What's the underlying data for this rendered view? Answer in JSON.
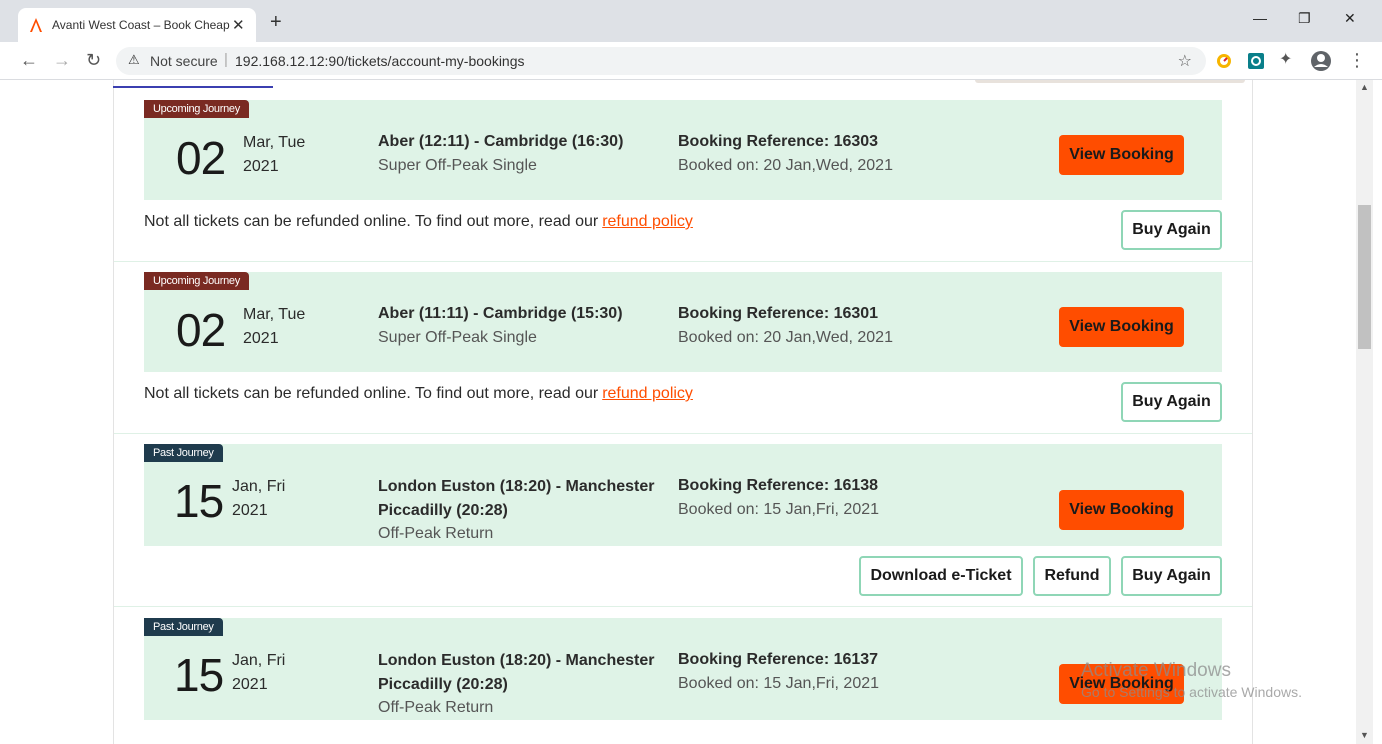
{
  "browser": {
    "tab_title": "Avanti West Coast – Book Cheap",
    "tab_close": "✕",
    "new_tab": "+",
    "not_secure": "Not secure",
    "url": "192.168.12.12:90/tickets/account-my-bookings"
  },
  "bookings": [
    {
      "badge": "Upcoming Journey",
      "day": "02",
      "mon": "Mar, Tue",
      "year": "2021",
      "route": "Aber (12:11) - Cambridge (16:30)",
      "ticket": "Super Off-Peak Single",
      "ref": "Booking Reference: 16303",
      "booked": "Booked on: 20 Jan,Wed, 2021",
      "view": "View Booking",
      "note": "Not all tickets can be refunded online. To find out more, read our",
      "link": "refund policy",
      "buy": "Buy Again"
    },
    {
      "badge": "Upcoming Journey",
      "day": "02",
      "mon": "Mar, Tue",
      "year": "2021",
      "route": "Aber (11:11) - Cambridge (15:30)",
      "ticket": "Super Off-Peak Single",
      "ref": "Booking Reference: 16301",
      "booked": "Booked on: 20 Jan,Wed, 2021",
      "view": "View Booking",
      "note": "Not all tickets can be refunded online. To find out more, read our",
      "link": "refund policy",
      "buy": "Buy Again"
    },
    {
      "badge": "Past Journey",
      "day": "15",
      "mon": "Jan, Fri",
      "year": "2021",
      "route": "London Euston (18:20) - Manchester Piccadilly (20:28)",
      "ticket": "Off-Peak Return",
      "ref": "Booking Reference: 16138",
      "booked": "Booked on: 15 Jan,Fri, 2021",
      "view": "View Booking",
      "download": "Download e-Ticket",
      "refund": "Refund",
      "buy": "Buy Again"
    },
    {
      "badge": "Past Journey",
      "day": "15",
      "mon": "Jan, Fri",
      "year": "2021",
      "route": "London Euston (18:20) - Manchester Piccadilly (20:28)",
      "ticket": "Off-Peak Return",
      "ref": "Booking Reference: 16137",
      "booked": "Booked on: 15 Jan,Fri, 2021",
      "view": "View Booking"
    }
  ],
  "watermark": {
    "line1": "Activate Windows",
    "line2": "Go to Settings to activate Windows."
  },
  "colors": {
    "accent": "#ff4d00",
    "card_bg": "#dff3e7",
    "badge_upcoming": "#7a2a22",
    "badge_past": "#1f3b4d",
    "outline_button": "#8fd6b6"
  }
}
